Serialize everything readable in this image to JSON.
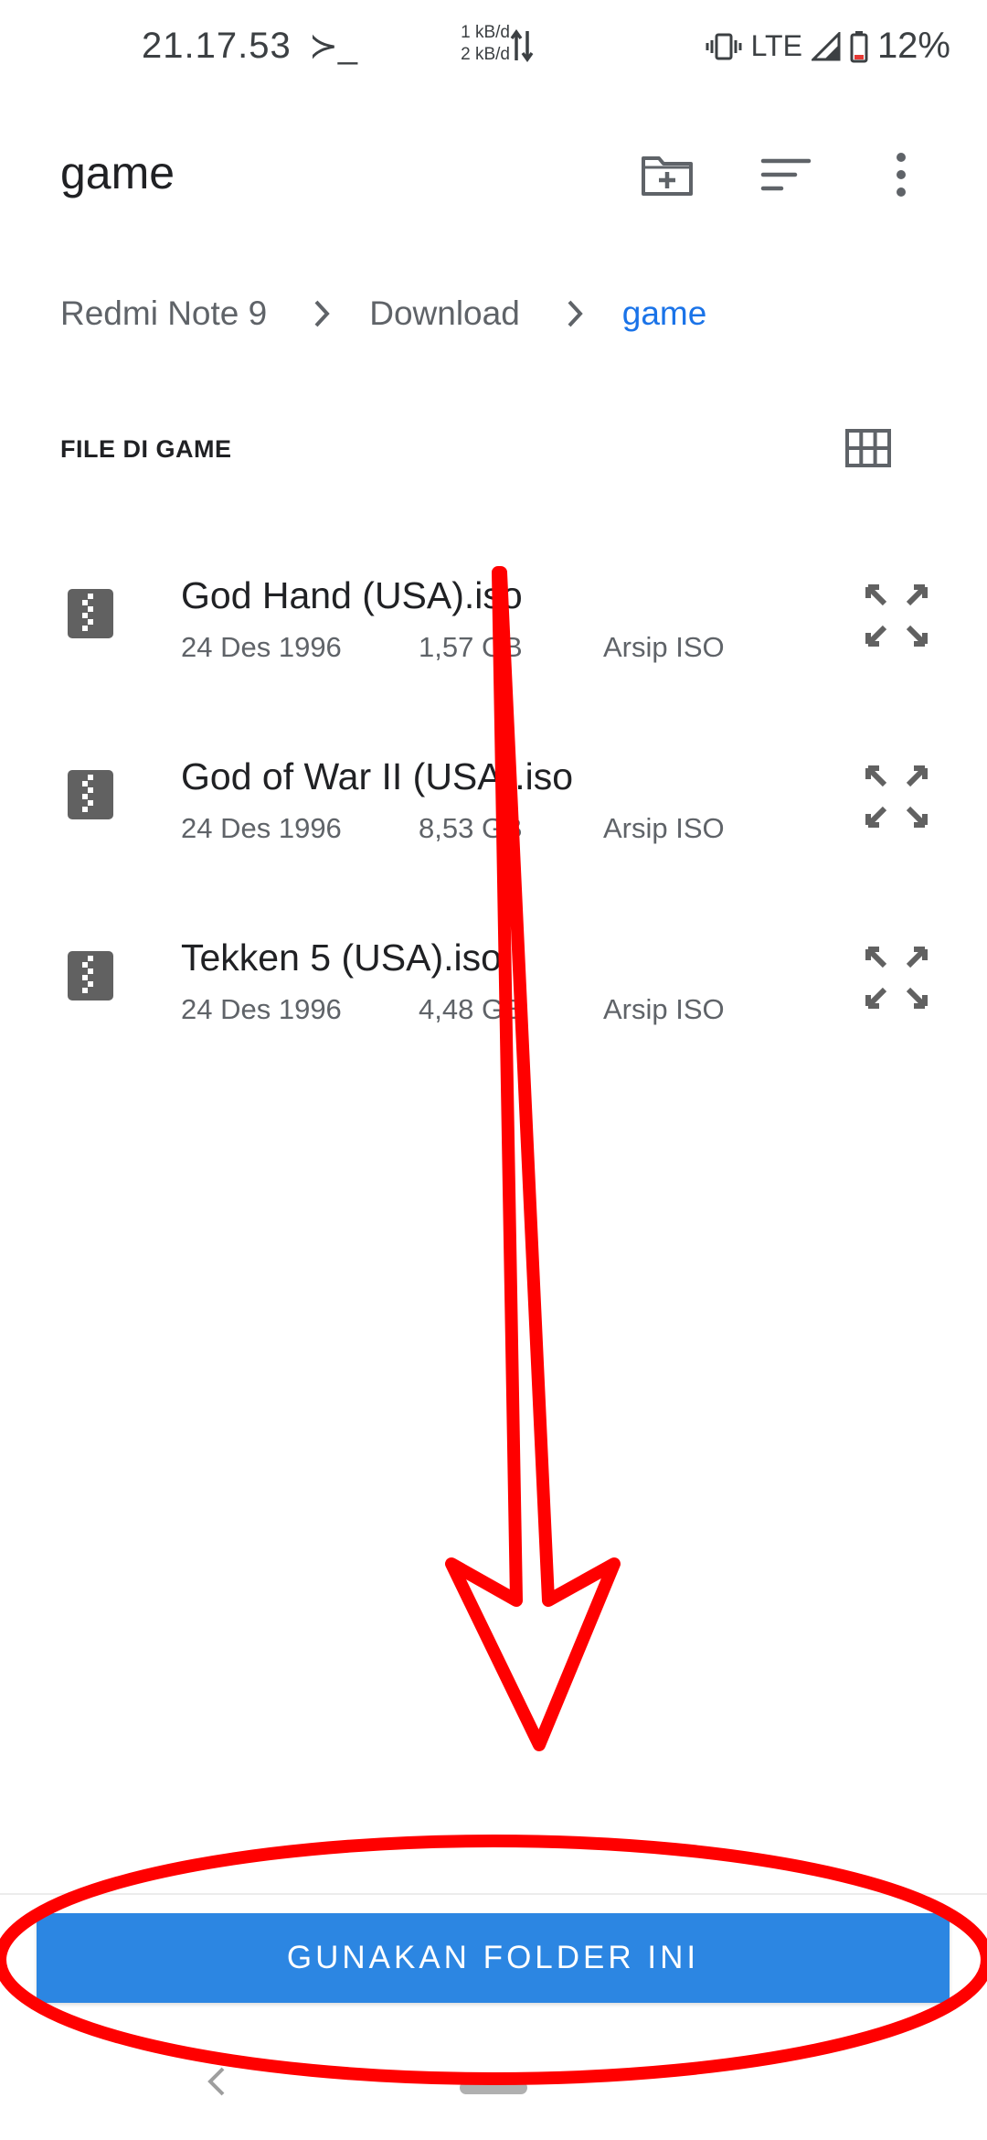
{
  "status_bar": {
    "time": "21.17.53",
    "terminal_glyph": "≻_",
    "net_up": "1 kB/d",
    "net_down": "2 kB/d",
    "network": "LTE",
    "battery": "12%"
  },
  "header": {
    "title": "game",
    "icons": [
      "new-folder-icon",
      "sort-icon",
      "more-options-icon"
    ]
  },
  "breadcrumb": {
    "items": [
      "Redmi Note 9",
      "Download",
      "game"
    ]
  },
  "section": {
    "title": "FILE DI GAME"
  },
  "files": [
    {
      "name": "God Hand (USA).iso",
      "date": "24 Des 1996",
      "size": "1,57 GB",
      "type": "Arsip ISO"
    },
    {
      "name": "God of War II (USA).iso",
      "date": "24 Des 1996",
      "size": "8,53 GB",
      "type": "Arsip ISO"
    },
    {
      "name": "Tekken 5 (USA).iso",
      "date": "24 Des 1996",
      "size": "4,48 GB",
      "type": "Arsip ISO"
    }
  ],
  "actions": {
    "use_folder": "GUNAKAN FOLDER INI"
  },
  "colors": {
    "accent": "#1a73e8",
    "button": "#2c86e2",
    "annotation": "#ff0000"
  }
}
